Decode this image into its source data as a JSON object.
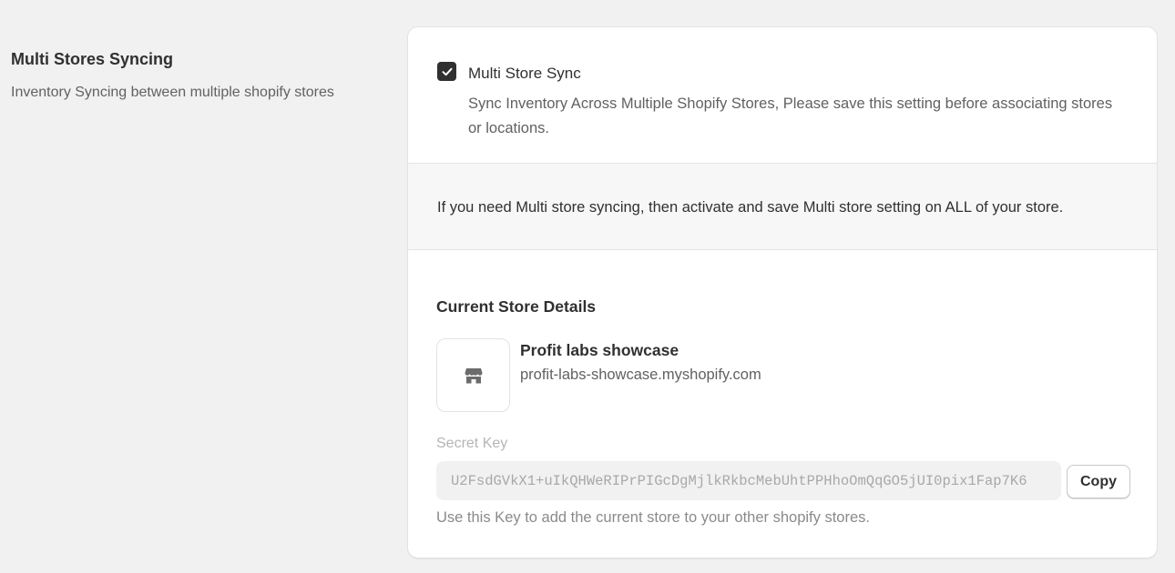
{
  "section": {
    "title": "Multi Stores Syncing",
    "description": "Inventory Syncing between multiple shopify stores"
  },
  "multi_store_sync": {
    "checked": true,
    "label": "Multi Store Sync",
    "help": "Sync Inventory Across Multiple Shopify Stores, Please save this setting before associating stores or locations."
  },
  "info_banner": {
    "text": "If you need Multi store syncing, then activate and save Multi store setting on ALL of your store."
  },
  "current_store": {
    "heading": "Current Store Details",
    "icon": "store-icon",
    "name": "Profit labs showcase",
    "domain": "profit-labs-showcase.myshopify.com"
  },
  "secret_key": {
    "label": "Secret Key",
    "value": "U2FsdGVkX1+uIkQHWeRIPrPIGcDgMjlkRkbcMebUhtPPHhoOmQqGO5jUI0pix1Fap7K6",
    "copy_label": "Copy",
    "help": "Use this Key to add the current store to your other shopify stores."
  }
}
